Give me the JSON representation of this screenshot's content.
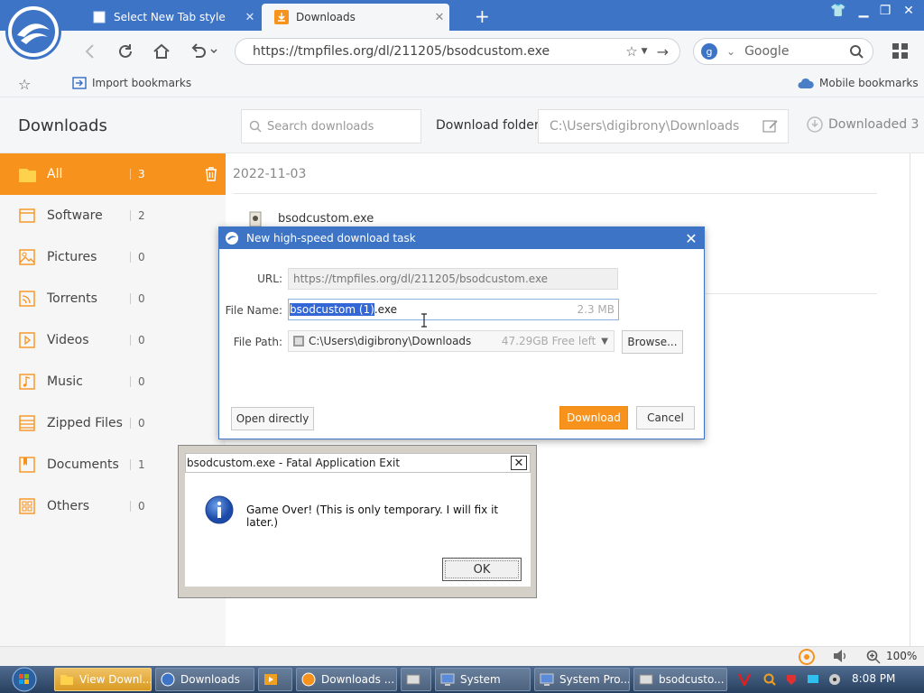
{
  "tabs": [
    {
      "label": "Select New Tab style",
      "icon": "tab-page-icon",
      "active": false
    },
    {
      "label": "Downloads",
      "icon": "download-arrow-icon",
      "active": true
    }
  ],
  "address": {
    "url": "https://tmpfiles.org/dl/211205/bsodcustom.exe"
  },
  "search": {
    "engine": "Google"
  },
  "bookmarks": {
    "import_label": "Import bookmarks",
    "mobile_label": "Mobile bookmarks"
  },
  "downloads_page": {
    "title": "Downloads",
    "search_placeholder": "Search downloads",
    "folder_label": "Download folder",
    "folder_path": "C:\\Users\\digibrony\\Downloads",
    "downloaded_label": "Downloaded 3",
    "date": "2022-11-03",
    "file_name": "bsodcustom.exe"
  },
  "sidebar": {
    "items": [
      {
        "label": "All",
        "count": "3",
        "icon": "folder-icon",
        "active": true
      },
      {
        "label": "Software",
        "count": "2",
        "icon": "software-icon"
      },
      {
        "label": "Pictures",
        "count": "0",
        "icon": "picture-icon"
      },
      {
        "label": "Torrents",
        "count": "0",
        "icon": "torrent-icon"
      },
      {
        "label": "Videos",
        "count": "0",
        "icon": "video-icon"
      },
      {
        "label": "Music",
        "count": "0",
        "icon": "music-icon"
      },
      {
        "label": "Zipped Files",
        "count": "0",
        "icon": "zip-icon"
      },
      {
        "label": "Documents",
        "count": "1",
        "icon": "document-icon"
      },
      {
        "label": "Others",
        "count": "0",
        "icon": "others-icon"
      }
    ]
  },
  "download_dialog": {
    "title": "New high-speed download task",
    "url_label": "URL:",
    "url_value": "https://tmpfiles.org/dl/211205/bsodcustom.exe",
    "file_name_label": "File Name:",
    "file_name_selected": "bsodcustom (1)",
    "file_name_ext": ".exe",
    "file_size": "2.3 MB",
    "file_path_label": "File Path:",
    "file_path_value": "C:\\Users\\digibrony\\Downloads",
    "free_space": "47.29GB Free left",
    "browse_label": "Browse...",
    "open_directly_label": "Open directly",
    "download_label": "Download",
    "cancel_label": "Cancel"
  },
  "error_dialog": {
    "title": "bsodcustom.exe - Fatal Application Exit",
    "message": "Game Over! (This is only temporary. I will fix it later.)",
    "ok_label": "OK"
  },
  "status_bar": {
    "zoom": "100%"
  },
  "taskbar": {
    "items": [
      {
        "label": "View Downl...",
        "active": true
      },
      {
        "label": "Downloads",
        "active": false
      },
      {
        "label": "",
        "active": false
      },
      {
        "label": "Downloads ...",
        "active": false
      },
      {
        "label": "",
        "active": false
      },
      {
        "label": "System",
        "active": false
      },
      {
        "label": "System Pro...",
        "active": false
      },
      {
        "label": "bsodcusto...",
        "active": false
      }
    ],
    "clock": "8:08 PM"
  },
  "colors": {
    "accent": "#f7931d",
    "brand_blue": "#3d74c6"
  }
}
